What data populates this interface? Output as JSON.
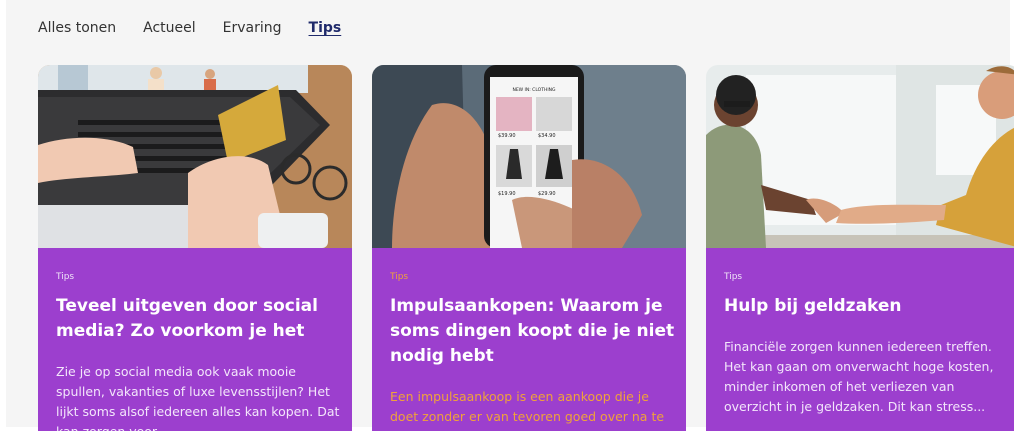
{
  "tabs": [
    {
      "label": "Alles tonen"
    },
    {
      "label": "Actueel"
    },
    {
      "label": "Ervaring"
    },
    {
      "label": "Tips",
      "active": true
    }
  ],
  "cards": [
    {
      "category": "Tips",
      "title": "Teveel uitgeven door social media? Zo voorkom je het",
      "description": "Zie je op social media ook vaak mooie spullen, vakanties of luxe levensstijlen? Het lijkt soms alsof iedereen alles kan kopen. Dat kan zorgen voor...",
      "image": "laptop-credit-card-shopping"
    },
    {
      "category": "Tips",
      "title": "Impulsaankopen: Waarom je soms dingen koopt die je niet nodig hebt",
      "description": "Een impulsaankoop is een aankoop die je doet zonder er van tevoren goed over na te denken. Dit kan soms leuk zijn, maar...",
      "image": "phone-online-clothing-shop",
      "accent_text_color": "#f0a23a",
      "phone_screen": {
        "header": "NEW IN: CLOTHING",
        "prices": [
          "$39.90",
          "$34.90",
          "$19.90",
          "$29.90"
        ]
      }
    },
    {
      "category": "Tips",
      "title": "Hulp bij geldzaken",
      "description": "Financiële zorgen kunnen iedereen treffen. Het kan gaan om onverwacht hoge kosten, minder inkomen of het verliezen van overzicht in je geldzaken. Dit kan stress...",
      "image": "people-shaking-hands"
    }
  ],
  "colors": {
    "card_background": "#9c3fce",
    "active_tab": "#1f2a6b",
    "page_background": "#f5f5f5"
  }
}
